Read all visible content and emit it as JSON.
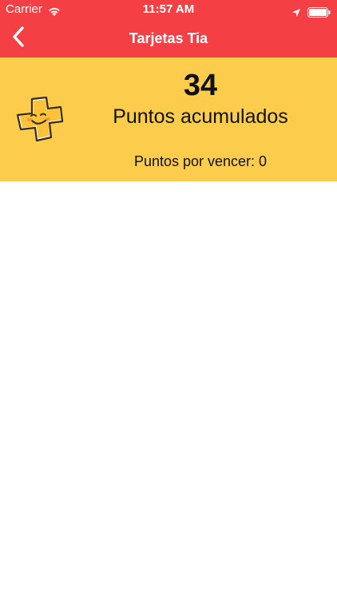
{
  "status_bar": {
    "carrier": "Carrier",
    "time": "11:57 AM",
    "wifi_icon": "wifi-icon",
    "location_icon": "location-arrow-icon",
    "battery_icon": "battery-icon"
  },
  "nav": {
    "title": "Tarjetas Tia",
    "back_icon": "chevron-left-icon"
  },
  "points": {
    "value": "34",
    "label": "Puntos acumulados",
    "expiring": "Puntos por vencer: 0",
    "mascot_icon": "tia-mascot-icon"
  },
  "colors": {
    "header_red": "#f43f45",
    "panel_yellow": "#fccd4d",
    "text_dark": "#111111",
    "white": "#ffffff"
  }
}
